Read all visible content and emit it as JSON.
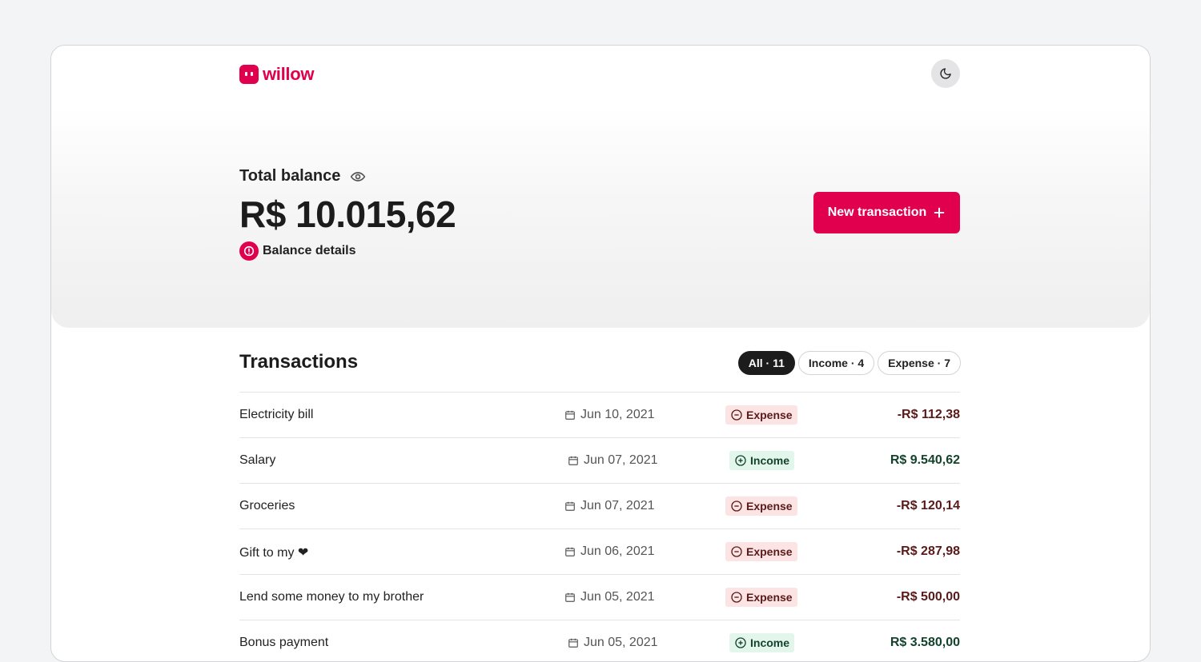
{
  "brand": {
    "name": "willow",
    "color": "#e0004d"
  },
  "header": {
    "theme_toggle_icon": "moon-icon"
  },
  "balance": {
    "label": "Total balance",
    "amount": "R$ 10.015,62",
    "details_label": "Balance details"
  },
  "actions": {
    "new_transaction": "New transaction"
  },
  "transactions": {
    "title": "Transactions",
    "filters": [
      {
        "label": "All · 11",
        "active": true
      },
      {
        "label": "Income · 4",
        "active": false
      },
      {
        "label": "Expense · 7",
        "active": false
      }
    ],
    "rows": [
      {
        "name": "Electricity bill",
        "date": "Jun 10, 2021",
        "type": "Expense",
        "amount": "-R$ 112,38"
      },
      {
        "name": "Salary",
        "date": "Jun 07, 2021",
        "type": "Income",
        "amount": "R$ 9.540,62"
      },
      {
        "name": "Groceries",
        "date": "Jun 07, 2021",
        "type": "Expense",
        "amount": "-R$ 120,14"
      },
      {
        "name": "Gift to my ❤",
        "date": "Jun 06, 2021",
        "type": "Expense",
        "amount": "-R$ 287,98"
      },
      {
        "name": "Lend some money to my brother",
        "date": "Jun 05, 2021",
        "type": "Expense",
        "amount": "-R$ 500,00"
      },
      {
        "name": "Bonus payment",
        "date": "Jun 05, 2021",
        "type": "Income",
        "amount": "R$ 3.580,00"
      }
    ]
  },
  "colors": {
    "expense_bg": "#fde4e4",
    "expense_text": "#5a1a1a",
    "income_bg": "#e2f6ec",
    "income_text": "#14432d"
  }
}
